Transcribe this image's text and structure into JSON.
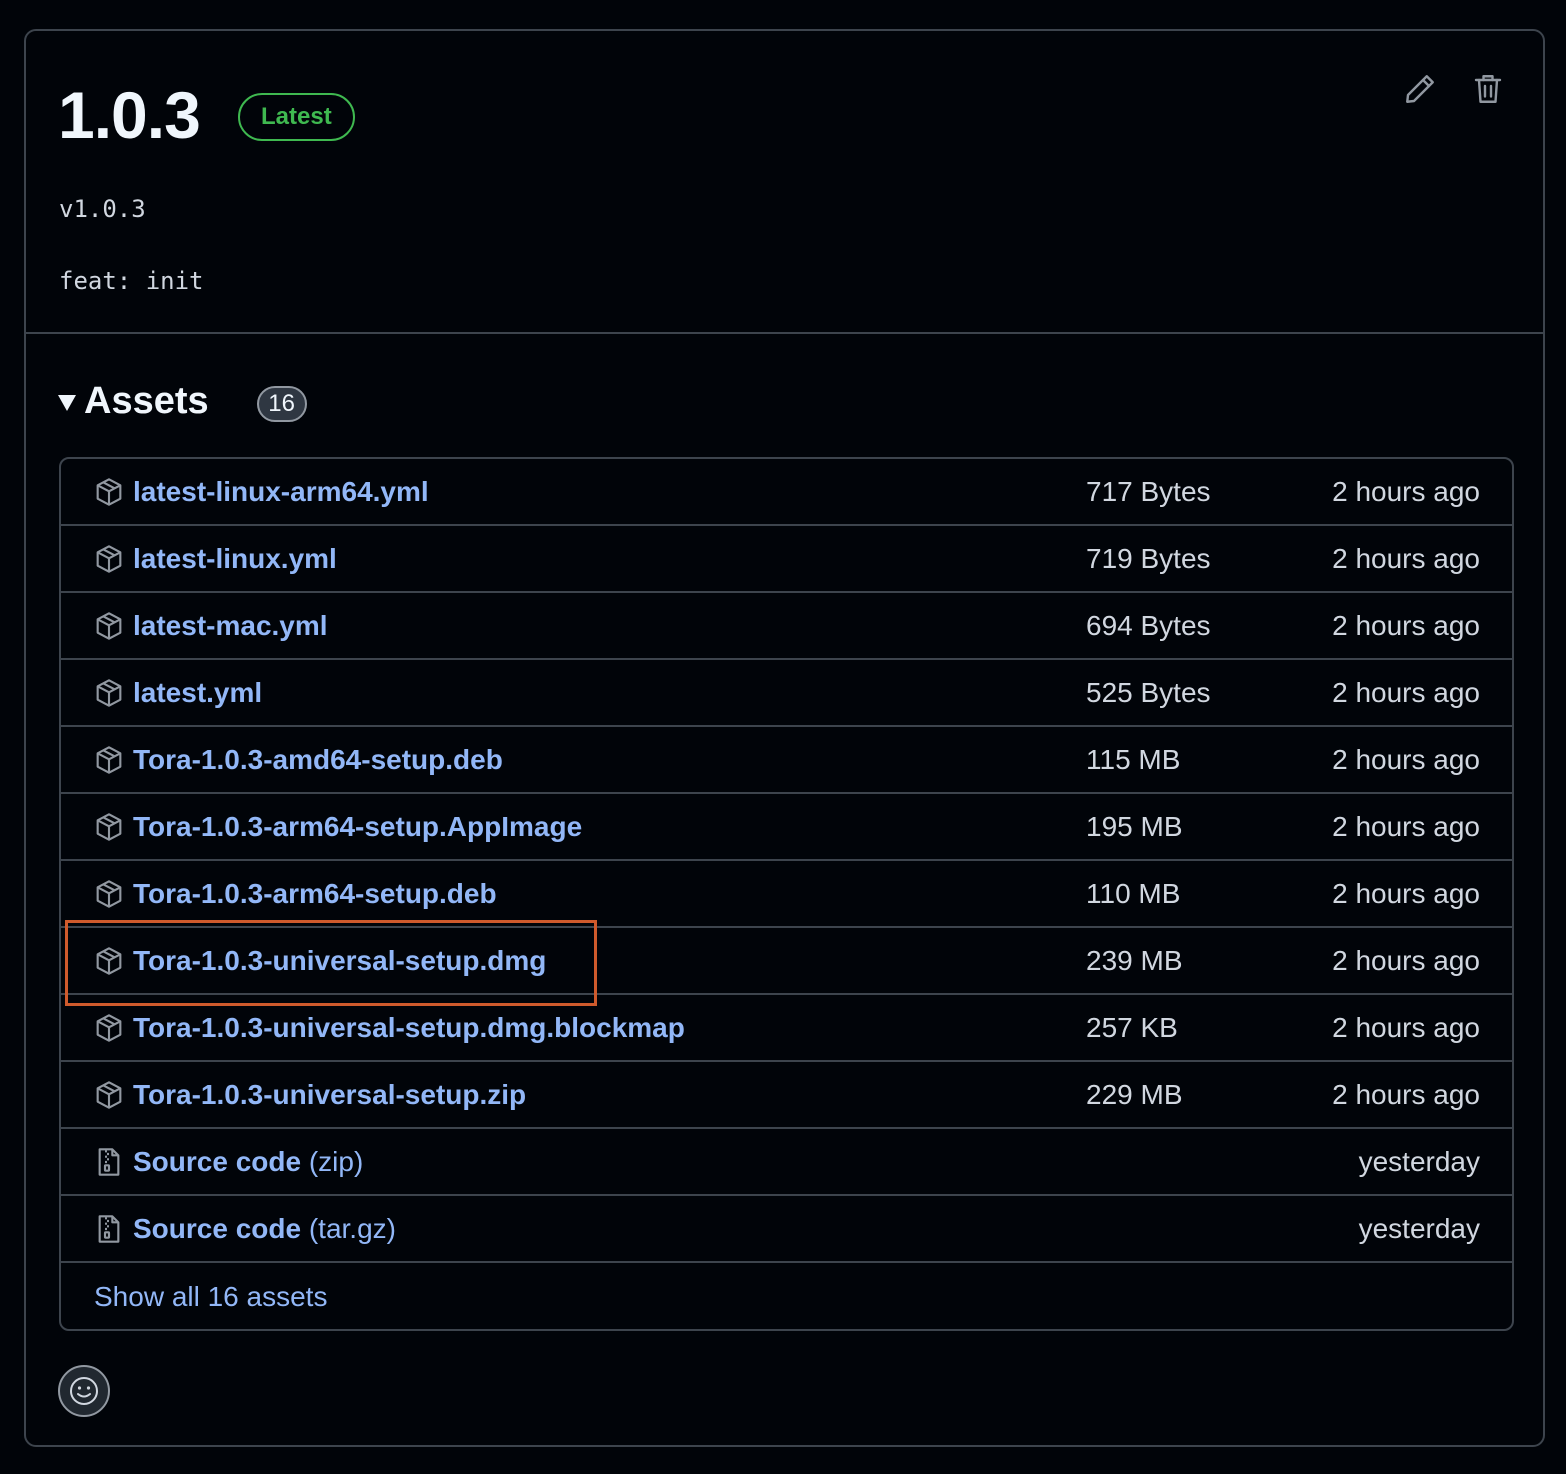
{
  "release": {
    "title": "1.0.3",
    "badge": "Latest",
    "tag": "v1.0.3",
    "commit_message": "feat: init"
  },
  "actions": {
    "edit_icon": "pencil-icon",
    "delete_icon": "trash-icon"
  },
  "assets": {
    "heading": "Assets",
    "count": "16",
    "items": [
      {
        "name": "latest-linux-arm64.yml",
        "suffix": "",
        "size": "717 Bytes",
        "time": "2 hours ago",
        "icon": "package-icon"
      },
      {
        "name": "latest-linux.yml",
        "suffix": "",
        "size": "719 Bytes",
        "time": "2 hours ago",
        "icon": "package-icon"
      },
      {
        "name": "latest-mac.yml",
        "suffix": "",
        "size": "694 Bytes",
        "time": "2 hours ago",
        "icon": "package-icon"
      },
      {
        "name": "latest.yml",
        "suffix": "",
        "size": "525 Bytes",
        "time": "2 hours ago",
        "icon": "package-icon"
      },
      {
        "name": "Tora-1.0.3-amd64-setup.deb",
        "suffix": "",
        "size": "115 MB",
        "time": "2 hours ago",
        "icon": "package-icon"
      },
      {
        "name": "Tora-1.0.3-arm64-setup.AppImage",
        "suffix": "",
        "size": "195 MB",
        "time": "2 hours ago",
        "icon": "package-icon"
      },
      {
        "name": "Tora-1.0.3-arm64-setup.deb",
        "suffix": "",
        "size": "110 MB",
        "time": "2 hours ago",
        "icon": "package-icon"
      },
      {
        "name": "Tora-1.0.3-universal-setup.dmg",
        "suffix": "",
        "size": "239 MB",
        "time": "2 hours ago",
        "icon": "package-icon"
      },
      {
        "name": "Tora-1.0.3-universal-setup.dmg.blockmap",
        "suffix": "",
        "size": "257 KB",
        "time": "2 hours ago",
        "icon": "package-icon"
      },
      {
        "name": "Tora-1.0.3-universal-setup.zip",
        "suffix": "",
        "size": "229 MB",
        "time": "2 hours ago",
        "icon": "package-icon"
      },
      {
        "name": "Source code",
        "suffix": " (zip)",
        "size": "",
        "time": "yesterday",
        "icon": "file-zip-icon"
      },
      {
        "name": "Source code",
        "suffix": " (tar.gz)",
        "size": "",
        "time": "yesterday",
        "icon": "file-zip-icon"
      }
    ],
    "show_all": "Show all 16 assets"
  },
  "reactions": {
    "icon": "smiley-icon"
  },
  "colors": {
    "background": "#010409",
    "border": "#3d444d",
    "link": "#92b7f7",
    "latest_green": "#3fb950",
    "highlight": "#cf5a2c"
  }
}
